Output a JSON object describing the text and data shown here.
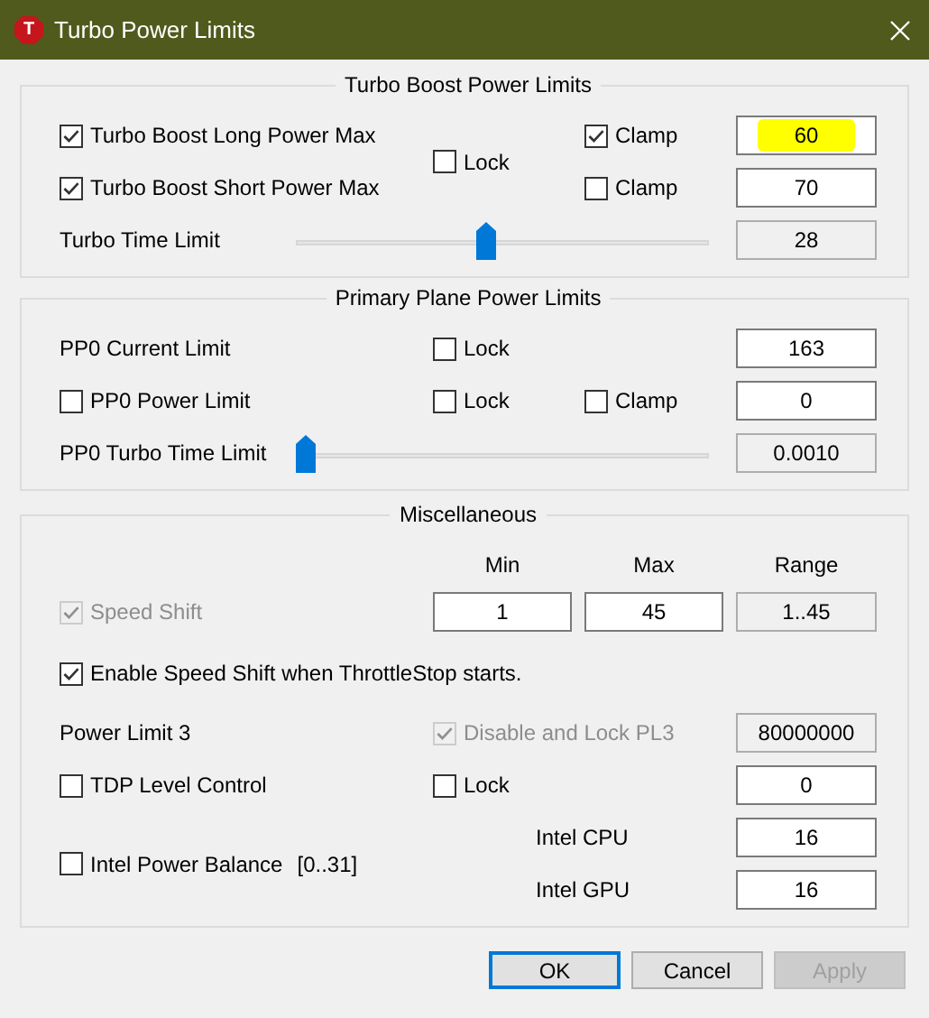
{
  "window": {
    "title": "Turbo Power Limits",
    "icon_letter": "T"
  },
  "turbo_boost": {
    "title": "Turbo Boost Power Limits",
    "long_power": {
      "label": "Turbo Boost Long Power Max",
      "checked": true,
      "disabled": false
    },
    "long_clamp": {
      "label": "Clamp",
      "checked": true,
      "disabled": false
    },
    "long_value": {
      "value": "60",
      "readonly": false,
      "highlighted": true
    },
    "short_power": {
      "label": "Turbo Boost Short Power Max",
      "checked": true,
      "disabled": false
    },
    "short_clamp": {
      "label": "Clamp",
      "checked": false,
      "disabled": false
    },
    "short_value": {
      "value": "70",
      "readonly": false,
      "highlighted": false
    },
    "lock": {
      "label": "Lock",
      "checked": false,
      "disabled": false
    },
    "time_limit": {
      "label": "Turbo Time Limit",
      "level": 0.46
    },
    "time_value": {
      "value": "28",
      "readonly": true,
      "highlighted": false
    }
  },
  "primary_plane": {
    "title": "Primary Plane Power Limits",
    "current_limit": {
      "label": "PP0 Current Limit"
    },
    "current_lock": {
      "label": "Lock",
      "checked": false,
      "disabled": false
    },
    "current_value": {
      "value": "163",
      "readonly": false,
      "highlighted": false
    },
    "power_limit": {
      "label": "PP0 Power Limit",
      "checked": false,
      "disabled": false
    },
    "power_lock": {
      "label": "Lock",
      "checked": false,
      "disabled": false
    },
    "power_clamp": {
      "label": "Clamp",
      "checked": false,
      "disabled": false
    },
    "power_value": {
      "value": "0",
      "readonly": false,
      "highlighted": false
    },
    "time_limit": {
      "label": "PP0 Turbo Time Limit",
      "level": 0
    },
    "time_value": {
      "value": "0.0010",
      "readonly": true,
      "highlighted": false
    }
  },
  "miscellaneous": {
    "title": "Miscellaneous",
    "columns": [
      "Min",
      "Max",
      "Range"
    ],
    "speed_shift": {
      "label": "Speed Shift",
      "checked": true,
      "disabled": true
    },
    "min_value": {
      "value": "1",
      "readonly": false,
      "highlighted": false
    },
    "max_value": {
      "value": "45",
      "readonly": false,
      "highlighted": false
    },
    "range_value": {
      "value": "1..45",
      "readonly": true,
      "highlighted": false
    },
    "enable_speed_shift": {
      "label": "Enable Speed Shift when ThrottleStop starts.",
      "checked": true,
      "disabled": false
    },
    "power_limit_3": {
      "label": "Power Limit 3"
    },
    "disable_lock_pl3": {
      "label": "Disable and Lock PL3",
      "checked": true,
      "disabled": true
    },
    "pl3_value": {
      "value": "80000000",
      "readonly": true,
      "highlighted": false
    },
    "tdp_level_control": {
      "label": "TDP Level Control",
      "checked": false,
      "disabled": false
    },
    "tdp_lock": {
      "label": "Lock",
      "checked": false,
      "disabled": false
    },
    "tdp_value": {
      "value": "0",
      "readonly": false,
      "highlighted": false
    },
    "intel_power_balance": {
      "label": "Intel Power Balance",
      "range": "[0..31]",
      "checked": false,
      "disabled": false
    },
    "cpu": {
      "label": "Intel CPU"
    },
    "cpu_value": {
      "value": "16",
      "readonly": false,
      "highlighted": false
    },
    "gpu": {
      "label": "Intel GPU"
    },
    "gpu_value": {
      "value": "16",
      "readonly": false,
      "highlighted": false
    }
  },
  "buttons": [
    {
      "label": "OK",
      "default": true,
      "disabled": false
    },
    {
      "label": "Cancel",
      "default": false,
      "disabled": false
    },
    {
      "label": "Apply",
      "default": false,
      "disabled": true
    }
  ]
}
